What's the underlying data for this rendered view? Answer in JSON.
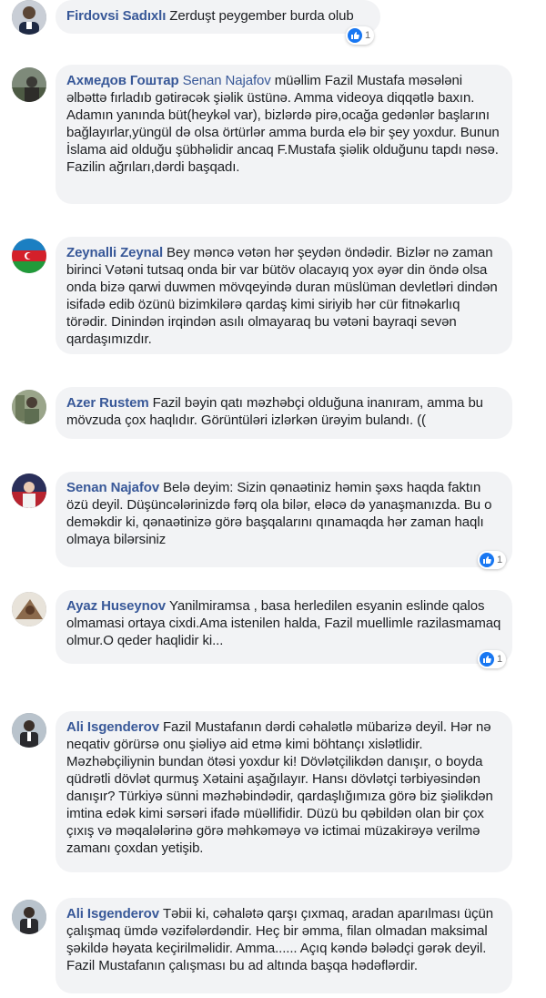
{
  "comments": [
    {
      "author": "Firdovsi Sadıxlı",
      "mention": "",
      "text": "Zerduşt peygember burda olub",
      "reactions": {
        "icon": "like-icon",
        "count": "1"
      }
    },
    {
      "author": "Ахмедов Гоштар",
      "mention": "Senan Najafov",
      "text": "müəllim Fazil Mustafa məsələni əlbəttə fırladıb gətirəcək şiəlik üstünə. Amma videoya diqqətlə baxın. Adamın yanında büt(heykəl var), bizlərdə pirə,ocağa gedənlər başlarını bağlayırlar,yüngül də olsa örtürlər amma burda elə bir şey yoxdur. Bunun İslama aid olduğu şübhəlidir ancaq F.Mustafa şiəlik olduğunu tapdı nəsə.",
      "text2": "Fazilin ağrıları,dərdi başqadı."
    },
    {
      "author": "Zeynalli Zeynal",
      "mention": "",
      "text": "Bey məncə vətən hər şeydən öndədir. Bizlər nə zaman birinci Vətəni tutsaq onda bir var bütöv olacayıq yox əyər din öndə olsa onda bizə qarwi duwmen mövqeyində duran müslüman devletləri dindən isifadə edib özünü bizimkilərə qardaş kimi siriyib hər cür fitnəkarlıq törədir. Dinindən irqindən asılı olmayaraq bu vətəni bayraqi sevən qardaşımızdır."
    },
    {
      "author": "Azer Rustem",
      "mention": "",
      "text": "Fazil bəyin qatı məzhəbçi olduğuna inanıram, amma bu mövzuda çox haqlıdır. Görüntüləri izlərkən ürəyim bulandı. (("
    },
    {
      "author": "Senan Najafov",
      "mention": "",
      "text": "Belə deyim: Sizin qənaətiniz həmin şəxs haqda faktın özü deyil. Düşüncələrinizdə fərq ola bilər, eləcə də yanaşmanızda. Bu o deməkdir ki, qənaətinizə görə başqalarını qınamaqda hər zaman haqlı olmaya bilərsiniz",
      "reactions": {
        "icon": "like-icon",
        "count": "1"
      }
    },
    {
      "author": "Ayaz Huseynov",
      "mention": "",
      "text": "Yanilmiramsa , basa herledilen esyanin eslinde qalos olmamasi ortaya cixdi.Ama istenilen halda, Fazil muellimle razilasmamaq olmur.O qeder haqlidir ki...",
      "reactions": {
        "icon": "like-icon",
        "count": "1"
      }
    },
    {
      "author": "Ali Isgenderov",
      "mention": "",
      "text": "Fazil Mustafanın dərdi cəhalətlə mübarizə deyil. Hər nə neqativ görürsə onu şiəliyə aid etmə kimi böhtançı xislətlidir. Məzhəbçiliynin bundan ötəsi yoxdur ki! Dövlətçilikdən danışır, o boyda qüdrətli dövlət qurmuş Xətaini aşağılayır. Hansı dövlətçi tərbiyəsindən danışır? Türkiyə sünni məzhəbindədir, qardaşlığımıza görə biz şiəlikdən imtina edək kimi sərsəri ifadə müəllifidir. Düzü bu qəbildən olan bir çox çıxış və məqalələrinə görə məhkəməyə və ictimai müzakirəyə verilmə zamanı çoxdan yetişib."
    },
    {
      "author": "Ali Isgenderov",
      "mention": "",
      "text": "Təbii ki, cəhalətə qarşı çıxmaq, aradan aparılması üçün çalışmaq ümdə vəzifələrdəndir. Heç bir əmma, filan olmadan maksimal şəkildə həyata keçirilməlidir. Amma...... Açıq kəndə bələdçi gərək deyil. Fazil Mustafanın çalışması bu ad altında başqa hədəflərdir."
    }
  ]
}
